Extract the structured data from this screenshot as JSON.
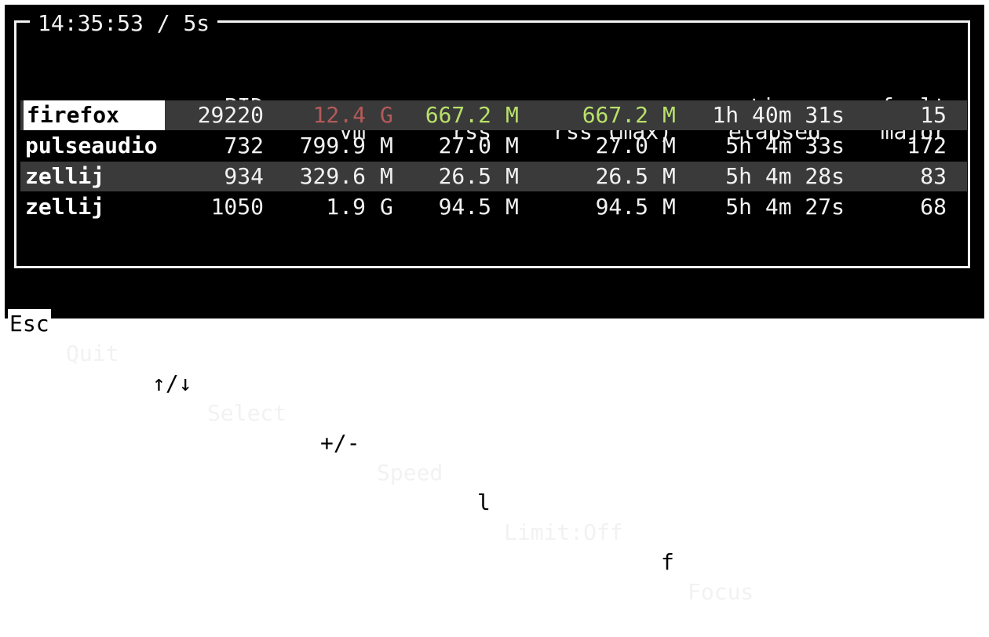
{
  "header": {
    "clock": "14:35:53",
    "sep": "/",
    "interval": "5s"
  },
  "columns": [
    {
      "line1": "PID",
      "line2": ""
    },
    {
      "line1": "mem",
      "line2": "vm"
    },
    {
      "line1": "mem",
      "line2": "rss"
    },
    {
      "line1": "mem",
      "line2": "rss (max)"
    },
    {
      "line1": "time",
      "line2": "elapsed"
    },
    {
      "line1": "fault",
      "line2": "major"
    }
  ],
  "rows": [
    {
      "name": "firefox",
      "pid": "29220",
      "vm": "12.4",
      "vm_unit": "G",
      "rss": "667.2",
      "rss_unit": "M",
      "rssmax": "667.2",
      "rssmax_unit": "M",
      "elapsed": "1h 40m 31s",
      "fault": "15"
    },
    {
      "name": "pulseaudio",
      "pid": "732",
      "vm": "799.9",
      "vm_unit": "M",
      "rss": "27.0",
      "rss_unit": "M",
      "rssmax": "27.0",
      "rssmax_unit": "M",
      "elapsed": "5h 4m 33s",
      "fault": "172"
    },
    {
      "name": "zellij",
      "pid": "934",
      "vm": "329.6",
      "vm_unit": "M",
      "rss": "26.5",
      "rss_unit": "M",
      "rssmax": "26.5",
      "rssmax_unit": "M",
      "elapsed": "5h 4m 28s",
      "fault": "83"
    },
    {
      "name": "zellij",
      "pid": "1050",
      "vm": "1.9",
      "vm_unit": "G",
      "rss": "94.5",
      "rss_unit": "M",
      "rssmax": "94.5",
      "rssmax_unit": "M",
      "elapsed": "5h 4m 27s",
      "fault": "68"
    }
  ],
  "footer": {
    "quit_key": "Esc",
    "quit_label": "Quit",
    "select_key": "↑/↓",
    "select_label": "Select",
    "speed_key": "+/-",
    "speed_label": "Speed",
    "limit_key": "l",
    "limit_label": "Limit:Off",
    "focus_key": "f",
    "focus_label": "Focus"
  },
  "colors": {
    "background": "#000000",
    "selected_bg": "#ffffff",
    "alt_row": "#3a3a3a",
    "vm_highlight": "#b35a5a",
    "rss_highlight": "#b8e06a"
  }
}
